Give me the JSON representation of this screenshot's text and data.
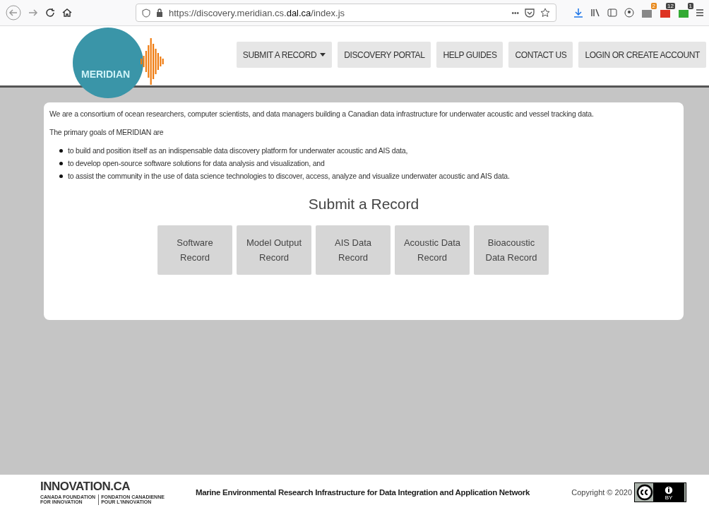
{
  "browser": {
    "url_prefix": "https://discovery.meridian.cs.",
    "url_domain": "dal.ca",
    "url_suffix": "/index.js",
    "more": "•••",
    "badges": [
      {
        "text": "2",
        "color": "#e8891c"
      },
      {
        "text": "12",
        "color": "#444444"
      },
      {
        "text": "1",
        "color": "#444444"
      }
    ]
  },
  "logo": {
    "text": "MERIDIAN"
  },
  "nav": [
    {
      "label": "SUBMIT A RECORD",
      "dropdown": true
    },
    {
      "label": "DISCOVERY PORTAL",
      "dropdown": false
    },
    {
      "label": "HELP GUIDES",
      "dropdown": false
    },
    {
      "label": "CONTACT US",
      "dropdown": false
    },
    {
      "label": "LOGIN OR CREATE ACCOUNT",
      "dropdown": false
    }
  ],
  "intro": "We are a consortium of ocean researchers, computer scientists, and data managers building a Canadian data infrastructure for underwater acoustic and vessel tracking data.",
  "goals_heading": "The primary goals of MERIDIAN are",
  "goals": [
    "to build and position itself as an indispensable data discovery platform for underwater acoustic and AIS data,",
    "to develop open-source software solutions for data analysis and visualization, and",
    "to assist the community in the use of data science technologies to discover, access, analyze and visualize underwater acoustic and AIS data."
  ],
  "submit_title": "Submit a Record",
  "records": [
    [
      "Software",
      "Record"
    ],
    [
      "Model Output",
      "Record"
    ],
    [
      "AIS Data",
      "Record"
    ],
    [
      "Acoustic Data",
      "Record"
    ],
    [
      "Bioacoustic",
      "Data Record"
    ]
  ],
  "footer": {
    "innovation_logo": "INNOVATION.CA",
    "innovation_en": [
      "CANADA FOUNDATION",
      "FOR INNOVATION"
    ],
    "innovation_fr": [
      "FONDATION CANADIENNE",
      "POUR L'INNOVATION"
    ],
    "tagline": "Marine Environmental Research Infrastructure for Data Integration and Application Network",
    "copyright": "Copyright © 2020",
    "license_mark": "BY"
  }
}
